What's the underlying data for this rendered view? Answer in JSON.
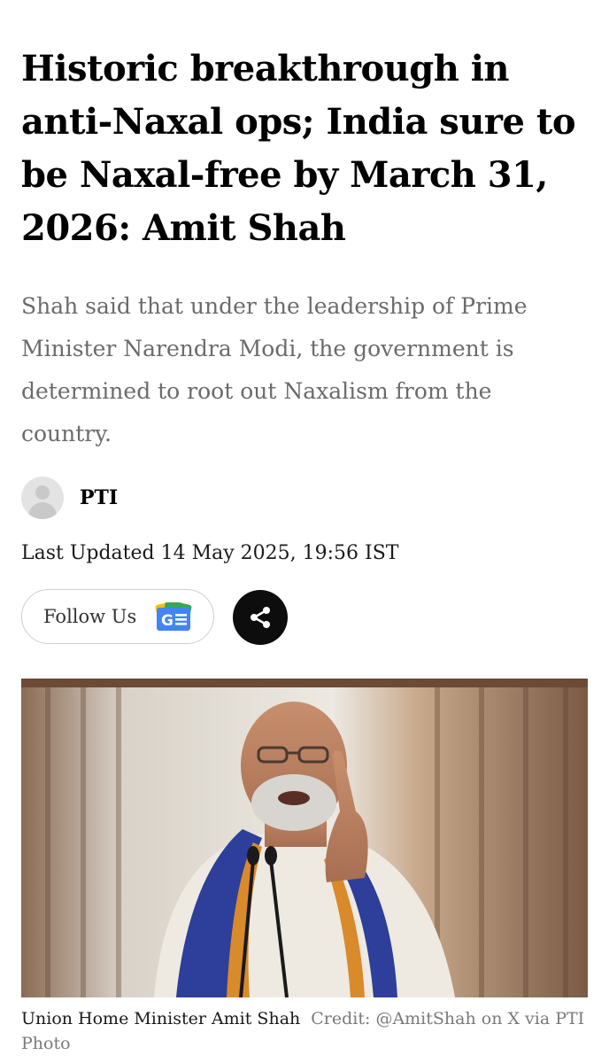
{
  "article": {
    "headline": "Historic breakthrough in anti-Naxal ops; India sure to be Naxal-free by March 31, 2026: Amit Shah",
    "summary": "Shah said that under the leadership of Prime Minister Narendra Modi, the government is determined to root out Naxalism from the country.",
    "author": "PTI",
    "updated": "Last Updated 14 May 2025, 19:56 IST"
  },
  "actions": {
    "follow_label": "Follow Us",
    "follow_icon": "google-news-icon",
    "share_icon": "share-icon"
  },
  "image": {
    "caption": "Union Home Minister Amit Shah",
    "credit": "Credit: @AmitShah on X via PTI Photo"
  },
  "colors": {
    "headline": "#000000",
    "summary": "#6b6b6b",
    "share_bg": "#0d0d0d",
    "follow_border": "#cfcfcf"
  }
}
